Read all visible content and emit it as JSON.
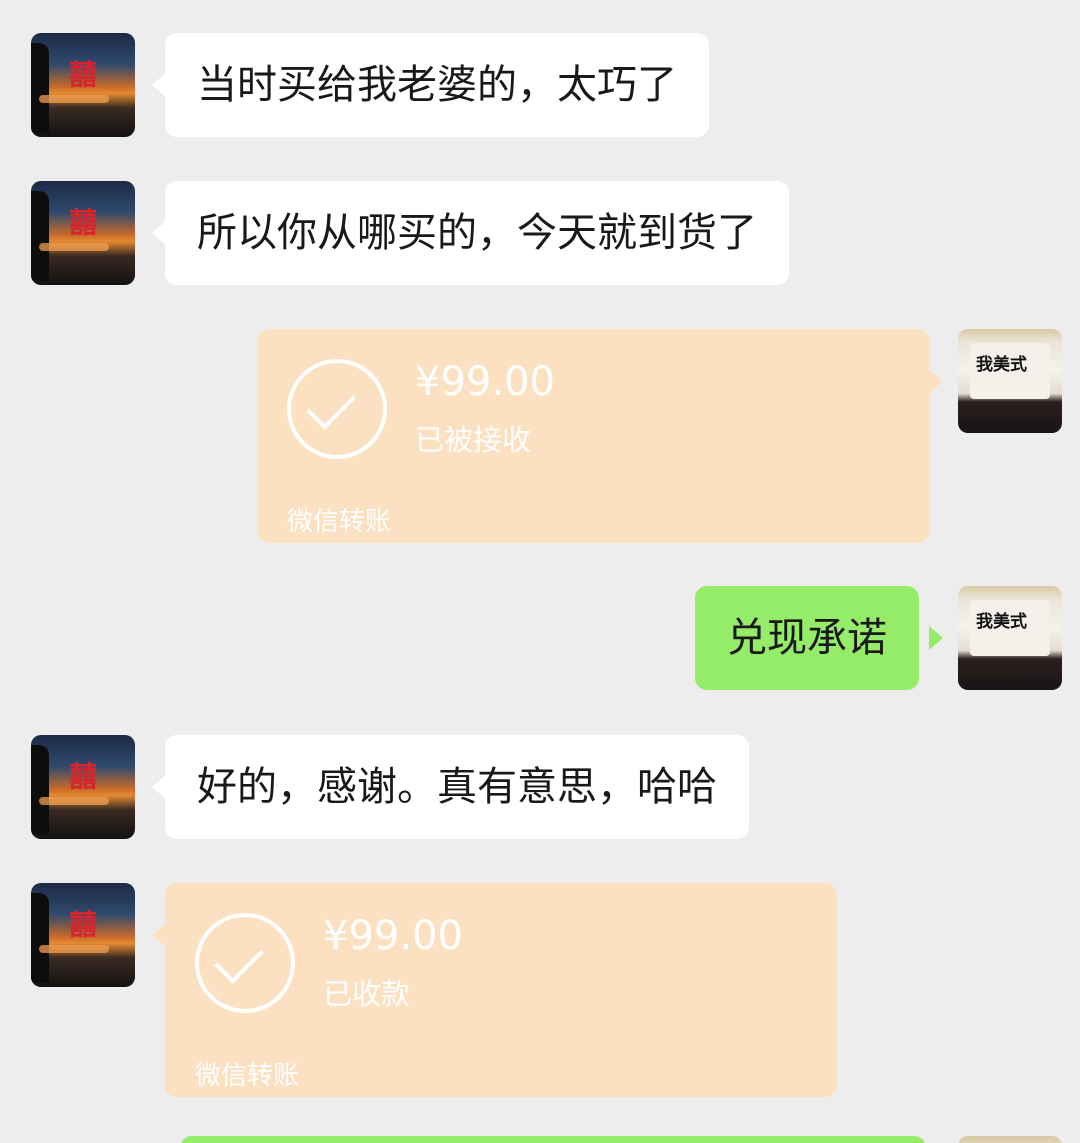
{
  "messages": [
    {
      "side": "left",
      "type": "text",
      "text": "当时买给我老婆的，太巧了"
    },
    {
      "side": "left",
      "type": "text",
      "text": "所以你从哪买的，今天就到货了"
    },
    {
      "side": "right",
      "type": "transfer",
      "amount": "¥99.00",
      "status": "已被接收",
      "footer": "微信转账"
    },
    {
      "side": "right",
      "type": "text",
      "text": "兑现承诺"
    },
    {
      "side": "left",
      "type": "text",
      "text": "好的，感谢。真有意思，哈哈"
    },
    {
      "side": "left",
      "type": "transfer",
      "amount": "¥99.00",
      "status": "已收款",
      "footer": "微信转账"
    }
  ],
  "avatars": {
    "left": {
      "glyph": "囍"
    },
    "right": {
      "brand_text": "我美式"
    }
  },
  "colors": {
    "background": "#ededed",
    "white_bubble": "#ffffff",
    "green_bubble": "#95ec69",
    "transfer_card": "#fbe0c1"
  }
}
